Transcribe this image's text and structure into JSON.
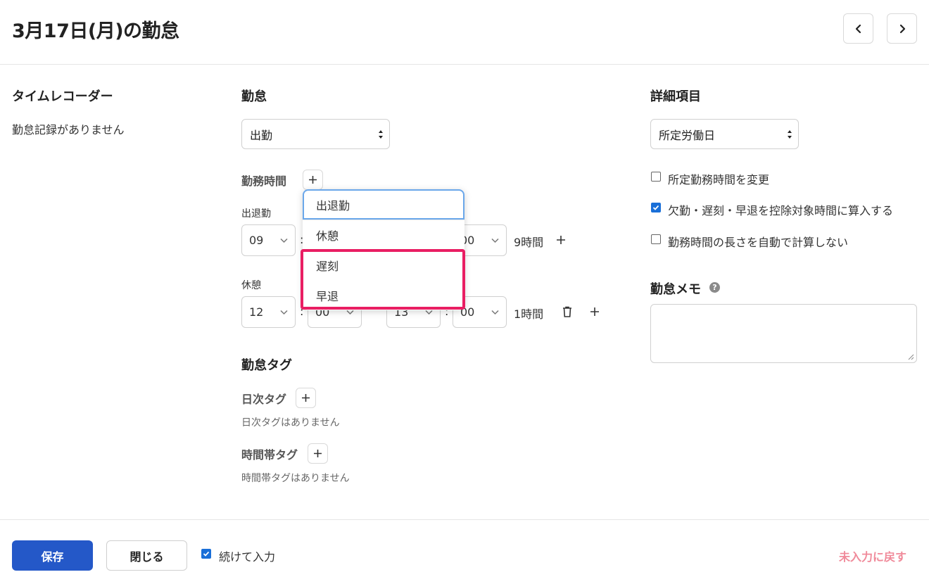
{
  "header": {
    "title": "3月17日(月)の勤怠",
    "prev_icon": "chevron-left-icon",
    "next_icon": "chevron-right-icon"
  },
  "time_recorder": {
    "title": "タイムレコーダー",
    "empty_text": "勤怠記録がありません"
  },
  "attendance": {
    "title": "勤怠",
    "type_value": "出勤",
    "work_hours_label": "勤務時間",
    "rows": [
      {
        "label": "出退勤",
        "start_hour": "09",
        "start_minute": "",
        "end_hour": "",
        "end_minute": "00",
        "duration": "9時間"
      },
      {
        "label": "休憩",
        "start_hour": "12",
        "start_minute": "00",
        "end_hour": "13",
        "end_minute": "00",
        "duration": "1時間"
      }
    ],
    "colon": ":"
  },
  "dropdown": {
    "items": [
      "出退勤",
      "休憩",
      "遅刻",
      "早退"
    ],
    "focused_index": 0,
    "highlighted": [
      "遅刻",
      "早退"
    ]
  },
  "tags": {
    "title": "勤怠タグ",
    "daily_label": "日次タグ",
    "daily_empty": "日次タグはありません",
    "time_label": "時間帯タグ",
    "time_empty": "時間帯タグはありません"
  },
  "details": {
    "title": "詳細項目",
    "day_type_value": "所定労働日",
    "options": [
      {
        "label": "所定勤務時間を変更",
        "checked": false
      },
      {
        "label": "欠勤・遅刻・早退を控除対象時間に算入する",
        "checked": true
      },
      {
        "label": "勤務時間の長さを自動で計算しない",
        "checked": false
      }
    ],
    "memo_label": "勤怠メモ",
    "memo_value": "",
    "help_glyph": "?"
  },
  "footer": {
    "save_label": "保存",
    "close_label": "閉じる",
    "continue_label": "続けて入力",
    "continue_checked": true,
    "reset_label": "未入力に戻す"
  },
  "colors": {
    "primary": "#2458c8",
    "checkbox": "#1a6fd8",
    "highlight": "#e91e63",
    "reset_link": "#f08a9a",
    "focus": "#6aa7ea"
  }
}
